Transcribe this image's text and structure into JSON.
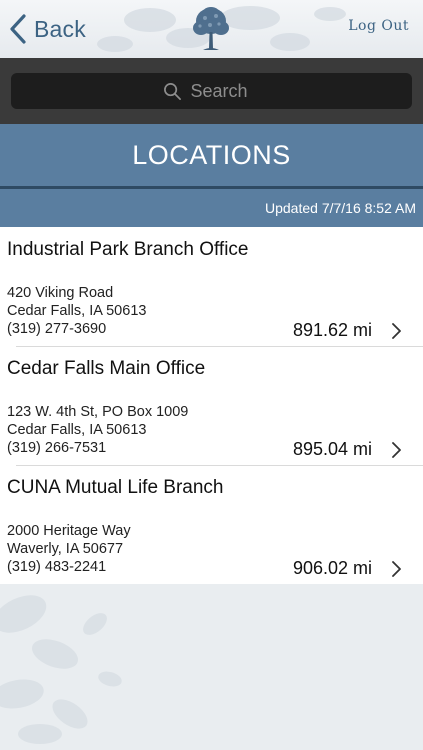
{
  "nav": {
    "back_label": "Back",
    "logout_label": "Log Out",
    "logo_icon": "tree-logo-icon"
  },
  "search": {
    "placeholder": "Search",
    "value": ""
  },
  "header": {
    "title": "LOCATIONS",
    "updated": "Updated 7/7/16 8:52 AM"
  },
  "locations": [
    {
      "name": "Industrial Park Branch Office",
      "address1": "420 Viking Road",
      "address2": "Cedar Falls, IA 50613",
      "phone": "(319) 277-3690",
      "distance": "891.62 mi"
    },
    {
      "name": "Cedar Falls Main Office",
      "address1": "123 W. 4th St, PO Box 1009",
      "address2": "Cedar Falls, IA 50613",
      "phone": "(319) 266-7531",
      "distance": "895.04 mi"
    },
    {
      "name": "CUNA Mutual Life Branch",
      "address1": "2000 Heritage Way",
      "address2": "Waverly, IA 50677",
      "phone": "(319) 483-2241",
      "distance": "906.02 mi"
    }
  ],
  "colors": {
    "accent": "#3c6383",
    "band": "#5a7ea0",
    "search_bg": "#3a3a3a"
  }
}
